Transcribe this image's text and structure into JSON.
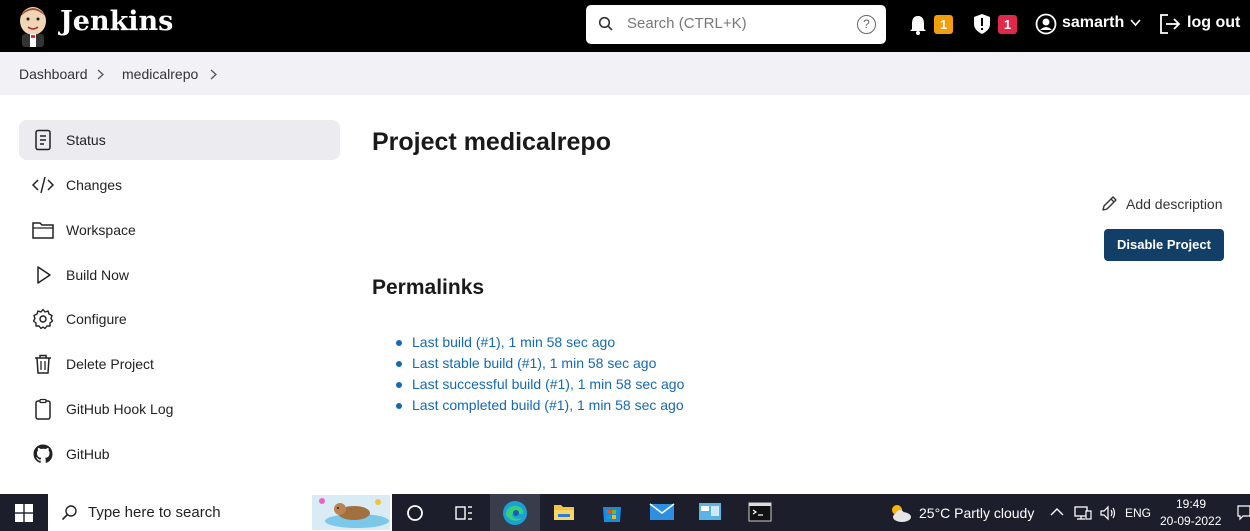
{
  "header": {
    "brand": "Jenkins",
    "search_placeholder": "Search (CTRL+K)",
    "help": "?",
    "notifications_count": "1",
    "security_count": "1",
    "user": "samarth",
    "logout": "log out"
  },
  "breadcrumb": [
    "Dashboard",
    "medicalrepo"
  ],
  "sidebar": {
    "items": [
      {
        "label": "Status",
        "icon": "status-icon"
      },
      {
        "label": "Changes",
        "icon": "code-icon"
      },
      {
        "label": "Workspace",
        "icon": "folder-icon"
      },
      {
        "label": "Build Now",
        "icon": "play-icon"
      },
      {
        "label": "Configure",
        "icon": "gear-icon"
      },
      {
        "label": "Delete Project",
        "icon": "trash-icon"
      },
      {
        "label": "GitHub Hook Log",
        "icon": "clipboard-icon"
      },
      {
        "label": "GitHub",
        "icon": "github-icon"
      }
    ]
  },
  "main": {
    "title": "Project medicalrepo",
    "add_description": "Add description",
    "disable_button": "Disable Project",
    "permalinks_title": "Permalinks",
    "permalinks": [
      "Last build (#1), 1 min 58 sec ago",
      "Last stable build (#1), 1 min 58 sec ago",
      "Last successful build (#1), 1 min 58 sec ago",
      "Last completed build (#1), 1 min 58 sec ago"
    ]
  },
  "taskbar": {
    "search_placeholder": "Type here to search",
    "weather": "25°C  Partly cloudy",
    "lang": "ENG",
    "time": "19:49",
    "date": "20-09-2022"
  },
  "colors": {
    "header_bg": "#000000",
    "accent": "#123f67",
    "link": "#1469b3",
    "badge_orange": "#f59e0b",
    "badge_red": "#e0294a"
  }
}
